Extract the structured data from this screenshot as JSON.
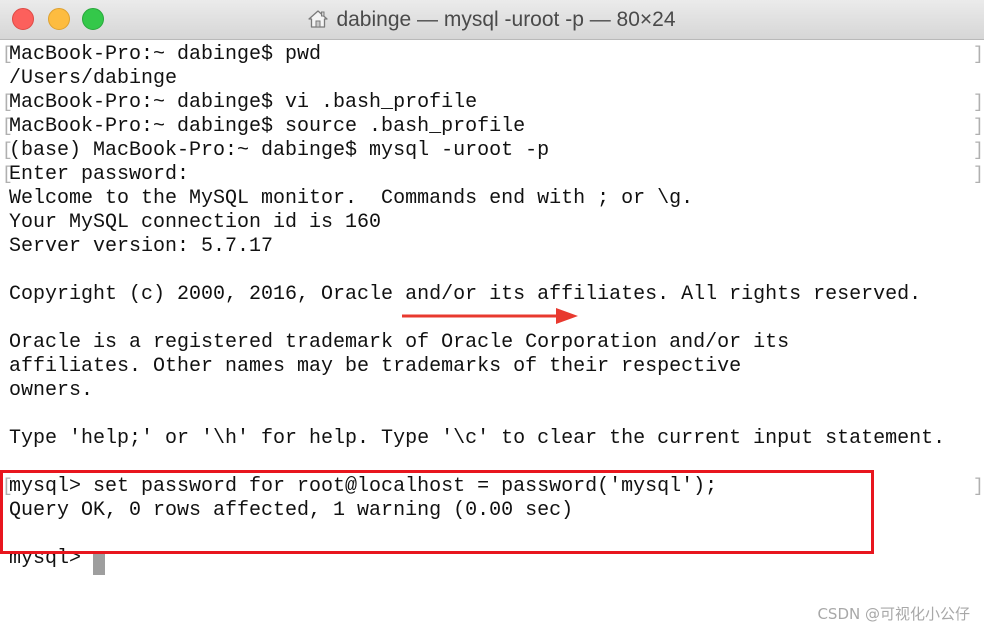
{
  "window": {
    "title": "dabinge — mysql -uroot -p — 80×24",
    "title_icon": "home-folder-icon"
  },
  "terminal": {
    "lines": [
      "MacBook-Pro:~ dabinge$ pwd",
      "/Users/dabinge",
      "MacBook-Pro:~ dabinge$ vi .bash_profile",
      "MacBook-Pro:~ dabinge$ source .bash_profile",
      "(base) MacBook-Pro:~ dabinge$ mysql -uroot -p",
      "Enter password:",
      "Welcome to the MySQL monitor.  Commands end with ; or \\g.",
      "Your MySQL connection id is 160",
      "Server version: 5.7.17",
      "",
      "Copyright (c) 2000, 2016, Oracle and/or its affiliates. All rights reserved.",
      "",
      "Oracle is a registered trademark of Oracle Corporation and/or its",
      "affiliates. Other names may be trademarks of their respective",
      "owners.",
      "",
      "Type 'help;' or '\\h' for help. Type '\\c' to clear the current input statement.",
      "",
      "mysql> set password for root@localhost = password('mysql');",
      "Query OK, 0 rows affected, 1 warning (0.00 sec)",
      "",
      "mysql> "
    ],
    "mark_left": "[",
    "mark_right": "]"
  },
  "annotations": {
    "box_color": "#e8161e",
    "arrow_color": "#e8392f"
  },
  "watermark": {
    "text": "CSDN @可视化小公仔"
  },
  "colors": {
    "close": "#fc605c",
    "minimize": "#fdbc40",
    "maximize": "#34c84a"
  }
}
